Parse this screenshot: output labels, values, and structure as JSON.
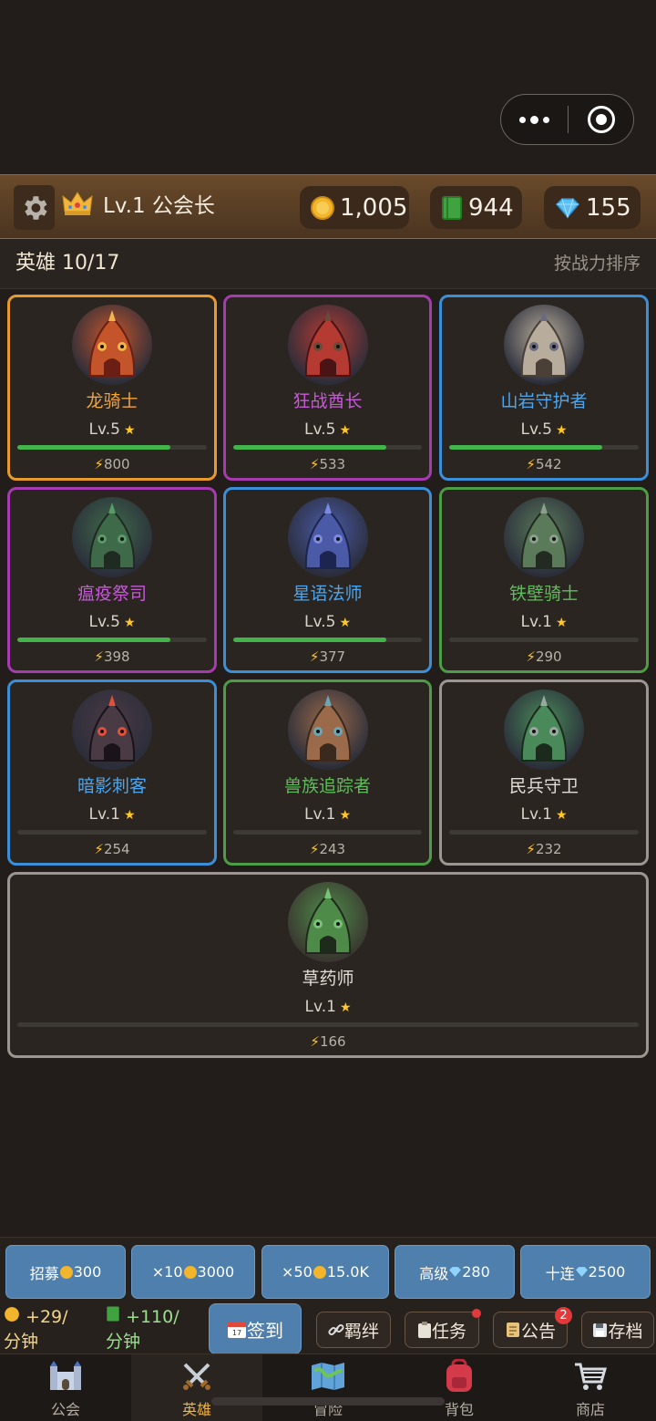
{
  "header": {
    "level_title": "Lv.1 公会长",
    "gold": "1,005",
    "books": "944",
    "gems": "155"
  },
  "heroes_bar": {
    "count_label": "英雄 10/17",
    "sort_label": "按战力排序"
  },
  "heroes": [
    {
      "name": "龙骑士",
      "level": "Lv.5",
      "power": "800",
      "xp": 0.81,
      "rarity_color": "#e89a2c",
      "name_color": "#f0a43a"
    },
    {
      "name": "狂战酋长",
      "level": "Lv.5",
      "power": "533",
      "xp": 0.81,
      "rarity_color": "#a63bb0",
      "name_color": "#c65ad6"
    },
    {
      "name": "山岩守护者",
      "level": "Lv.5",
      "power": "542",
      "xp": 0.81,
      "rarity_color": "#3b8fd8",
      "name_color": "#4aa6f0"
    },
    {
      "name": "瘟疫祭司",
      "level": "Lv.5",
      "power": "398",
      "xp": 0.81,
      "rarity_color": "#a63bb0",
      "name_color": "#c65ad6"
    },
    {
      "name": "星语法师",
      "level": "Lv.5",
      "power": "377",
      "xp": 0.81,
      "rarity_color": "#3b8fd8",
      "name_color": "#4aa6f0"
    },
    {
      "name": "铁壁骑士",
      "level": "Lv.1",
      "power": "290",
      "xp": 0,
      "rarity_color": "#4c9d45",
      "name_color": "#5cbf58"
    },
    {
      "name": "暗影刺客",
      "level": "Lv.1",
      "power": "254",
      "xp": 0,
      "rarity_color": "#3b8fd8",
      "name_color": "#4aa6f0"
    },
    {
      "name": "兽族追踪者",
      "level": "Lv.1",
      "power": "243",
      "xp": 0,
      "rarity_color": "#4c9d45",
      "name_color": "#5cbf58"
    },
    {
      "name": "民兵守卫",
      "level": "Lv.1",
      "power": "232",
      "xp": 0,
      "rarity_color": "#9b9691",
      "name_color": "#e2ddd6"
    },
    {
      "name": "草药师",
      "level": "Lv.1",
      "power": "166",
      "xp": 0,
      "rarity_color": "#9b9691",
      "name_color": "#e2ddd6"
    }
  ],
  "recruit": {
    "b1_label": "招募",
    "b1_cost": "300",
    "b2_label": "×10",
    "b2_cost": "3000",
    "b3_label": "×50",
    "b3_cost": "15.0K",
    "b4_label": "高级",
    "b4_cost": "280",
    "b5_label": "十连",
    "b5_cost": "2500"
  },
  "income": {
    "gold_rate": "+29/",
    "gold_unit": "分钟",
    "book_rate": "+110/",
    "book_unit": "分钟"
  },
  "side_buttons": {
    "checkin": "签到",
    "bond": "羁绊",
    "tasks": "任务",
    "notice": "公告",
    "notice_badge": "2",
    "save": "存档"
  },
  "tabs": [
    "公会",
    "英雄",
    "冒险",
    "背包",
    "商店"
  ],
  "active_tab": "英雄",
  "colors": {
    "accent": "#f2b63c",
    "button_blue": "#4f7fad",
    "xp_green": "#43b449",
    "star": "#ffc72a"
  },
  "icons": {
    "capsule": [
      "more-dots-icon",
      "close-target-icon"
    ],
    "header": [
      "gear-icon",
      "crown-icon",
      "gold-coin-icon",
      "green-book-icon",
      "diamond-icon"
    ],
    "tabs": [
      "castle-icon",
      "crossed-swords-icon",
      "map-icon",
      "backpack-icon",
      "cart-icon"
    ],
    "buttons": [
      "calendar-icon",
      "link-icon",
      "clipboard-icon",
      "scroll-icon",
      "floppy-disk-icon",
      "lightning-icon",
      "star-icon"
    ]
  }
}
